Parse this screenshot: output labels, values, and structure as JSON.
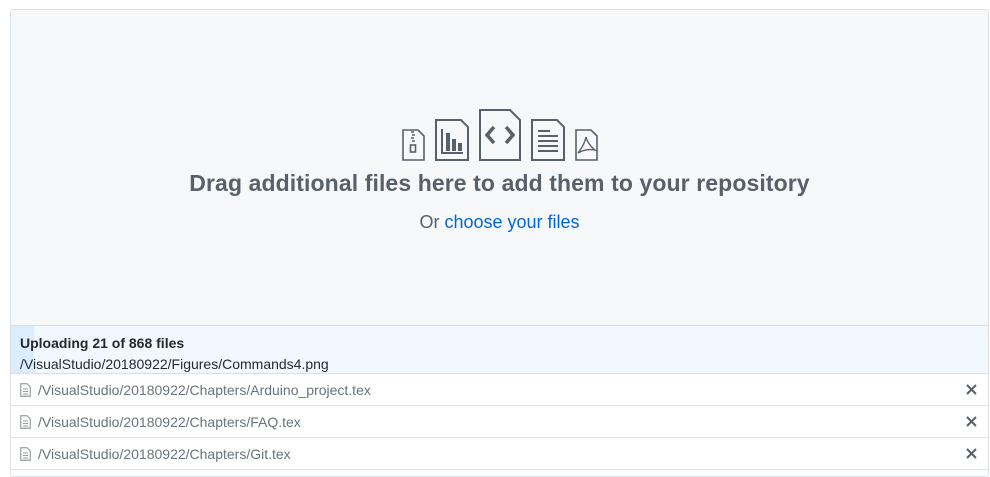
{
  "dropzone": {
    "icons": [
      "file-zip-icon",
      "file-chart-icon",
      "file-code-icon",
      "file-text-icon",
      "file-pdf-icon"
    ],
    "title": "Drag additional files here to add them to your repository",
    "choose_prefix": "Or ",
    "choose_link": "choose your files"
  },
  "upload": {
    "status": "Uploading 21 of 868 files",
    "current_file": "/VisualStudio/20180922/Figures/Commands4.png",
    "progress_fraction": 0.024
  },
  "files": [
    {
      "path": "/VisualStudio/20180922/Chapters/Arduino_project.tex"
    },
    {
      "path": "/VisualStudio/20180922/Chapters/FAQ.tex"
    },
    {
      "path": "/VisualStudio/20180922/Chapters/Git.tex"
    }
  ],
  "colors": {
    "link": "#0366d6",
    "icon": "#586069",
    "progress_bg": "#f1f8ff",
    "progress_fill": "#dbedff"
  }
}
